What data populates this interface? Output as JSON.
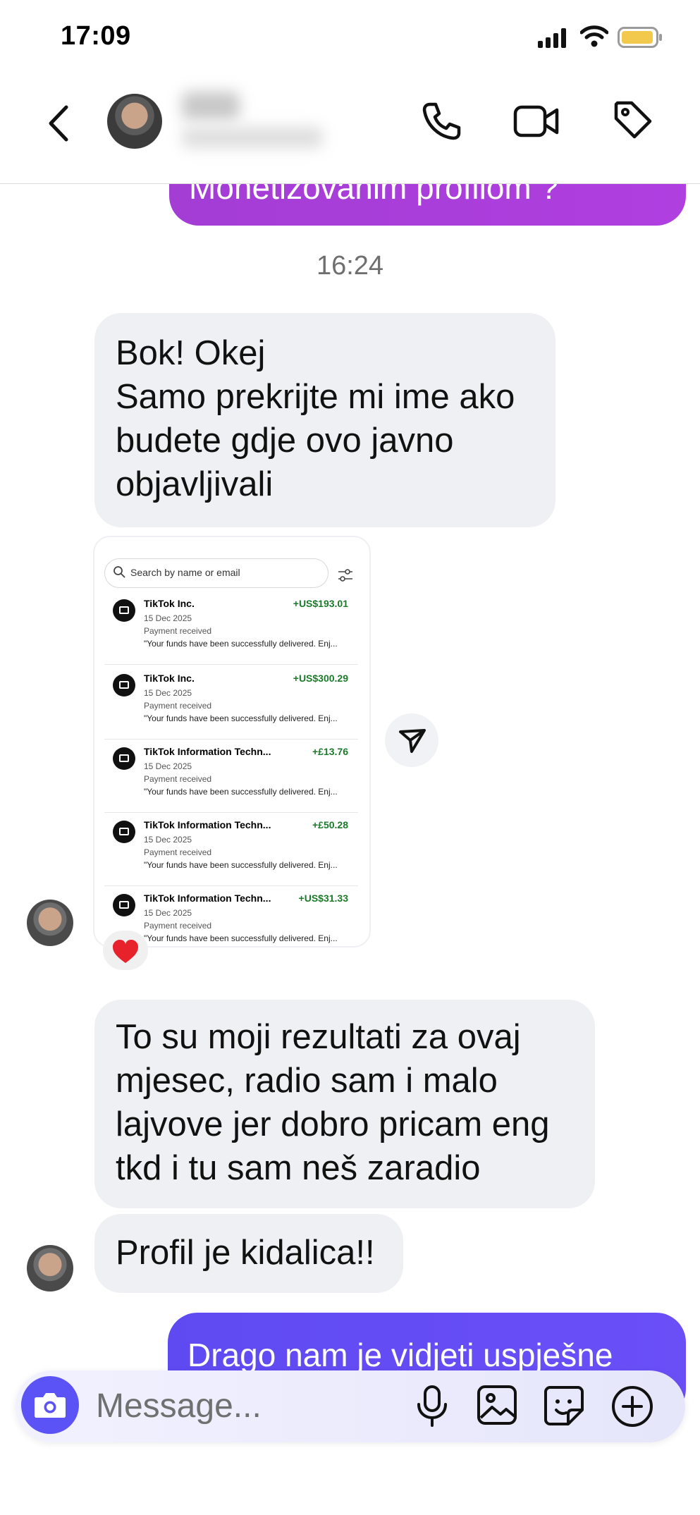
{
  "status_bar": {
    "time": "17:09"
  },
  "header": {
    "contact_name": "",
    "contact_subtitle": ""
  },
  "messages": {
    "outgoing_top": "Monetizovanim profilom ?",
    "timestamp": "16:24",
    "incoming_1": [
      "Bok! Okej",
      "Samo prekrijte mi ime ako",
      "budete gdje ovo javno",
      "objavljivali"
    ],
    "reaction": "❤️",
    "incoming_2": [
      "To su moji rezultati za ovaj",
      "mjesec, radio sam i malo",
      "lajvove jer dobro pricam eng",
      "tkd i tu sam neš zaradio"
    ],
    "incoming_3": "Profil je kidalica!!",
    "outgoing_bottom": "Drago nam je vidjeti uspješne"
  },
  "screenshot": {
    "search_placeholder": "Search by name or email",
    "transactions": [
      {
        "name": "TikTok Inc.",
        "amount": "+US$193.01",
        "date": "15 Dec 2025",
        "status": "Payment received",
        "note": "\"Your funds have been successfully delivered. Enj..."
      },
      {
        "name": "TikTok Inc.",
        "amount": "+US$300.29",
        "date": "15 Dec 2025",
        "status": "Payment received",
        "note": "\"Your funds have been successfully delivered. Enj..."
      },
      {
        "name": "TikTok Information Techn...",
        "amount": "+£13.76",
        "date": "15 Dec 2025",
        "status": "Payment received",
        "note": "\"Your funds have been successfully delivered. Enj..."
      },
      {
        "name": "TikTok Information Techn...",
        "amount": "+£50.28",
        "date": "15 Dec 2025",
        "status": "Payment received",
        "note": "\"Your funds have been successfully delivered. Enj..."
      },
      {
        "name": "TikTok Information Techn...",
        "amount": "+US$31.33",
        "date": "15 Dec 2025",
        "status": "Payment received",
        "note": "\"Your funds have been successfully delivered. Enj..."
      }
    ]
  },
  "composer": {
    "placeholder": "Message..."
  },
  "colors": {
    "outgoing_top": "#a33dd4",
    "outgoing_bottom": "#5f4af2",
    "incoming_bubble": "#eff0f3",
    "accent": "#5b53f5",
    "amount_green": "#1b7a2a"
  },
  "icons": [
    "back-icon",
    "phone-icon",
    "video-icon",
    "tag-icon",
    "share-icon",
    "camera-icon",
    "microphone-icon",
    "gallery-icon",
    "sticker-icon",
    "plus-icon"
  ]
}
